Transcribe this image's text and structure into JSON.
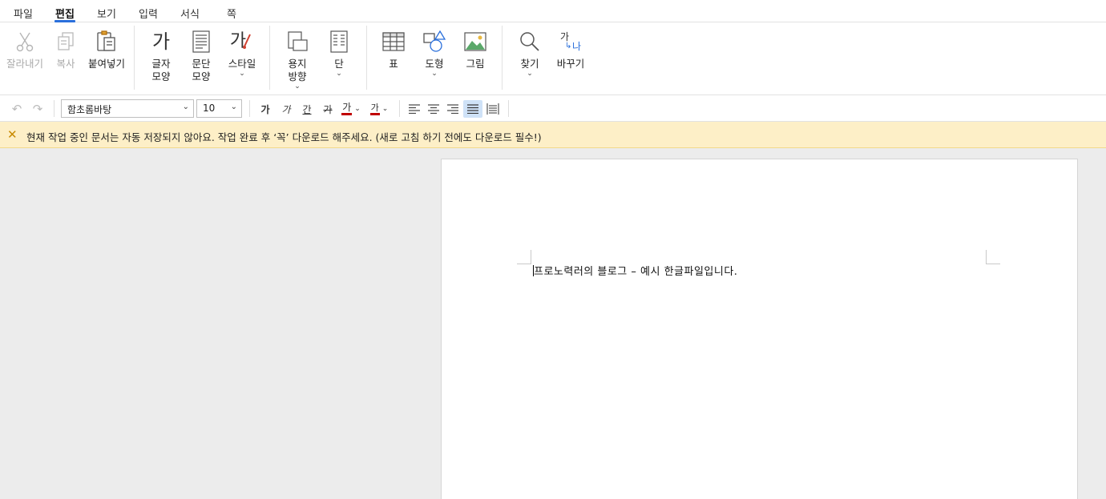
{
  "menu": {
    "items": [
      "파일",
      "편집",
      "보기",
      "입력",
      "서식",
      "쪽"
    ],
    "active": "편집"
  },
  "ribbon": {
    "cut": "잘라내기",
    "copy": "복사",
    "paste": "붙여넣기",
    "char_shape_line1": "글자",
    "char_shape_line2": "모양",
    "para_shape_line1": "문단",
    "para_shape_line2": "모양",
    "style": "스타일",
    "orientation_line1": "용지",
    "orientation_line2": "방향",
    "columns": "단",
    "table": "표",
    "shapes": "도형",
    "picture": "그림",
    "find": "찾기",
    "replace": "바꾸기",
    "char_shape_glyph": "가",
    "style_glyph": "가",
    "replace_glyph_a": "가",
    "replace_glyph_b": "나"
  },
  "toolbar": {
    "font_family": "함초롬바탕",
    "font_size": "10",
    "bold_glyph": "가",
    "italic_glyph": "가",
    "underline_glyph": "간",
    "strike_glyph": "가",
    "font_color_glyph": "가",
    "highlight_glyph": "가",
    "font_color": "#c00000",
    "highlight_color": "#c00000"
  },
  "notice": {
    "message": "현재 작업 중인 문서는 자동 저장되지 않아요. 작업 완료 후 ‘꼭’ 다운로드 해주세요. (새로 고침 하기 전에도 다운로드 필수!)"
  },
  "document": {
    "text": "프로노력러의 블로그 – 예시 한글파일입니다."
  },
  "colors": {
    "accent": "#2a6fdb",
    "notice_bg": "#fdefc7",
    "workspace_bg": "#ececec"
  }
}
